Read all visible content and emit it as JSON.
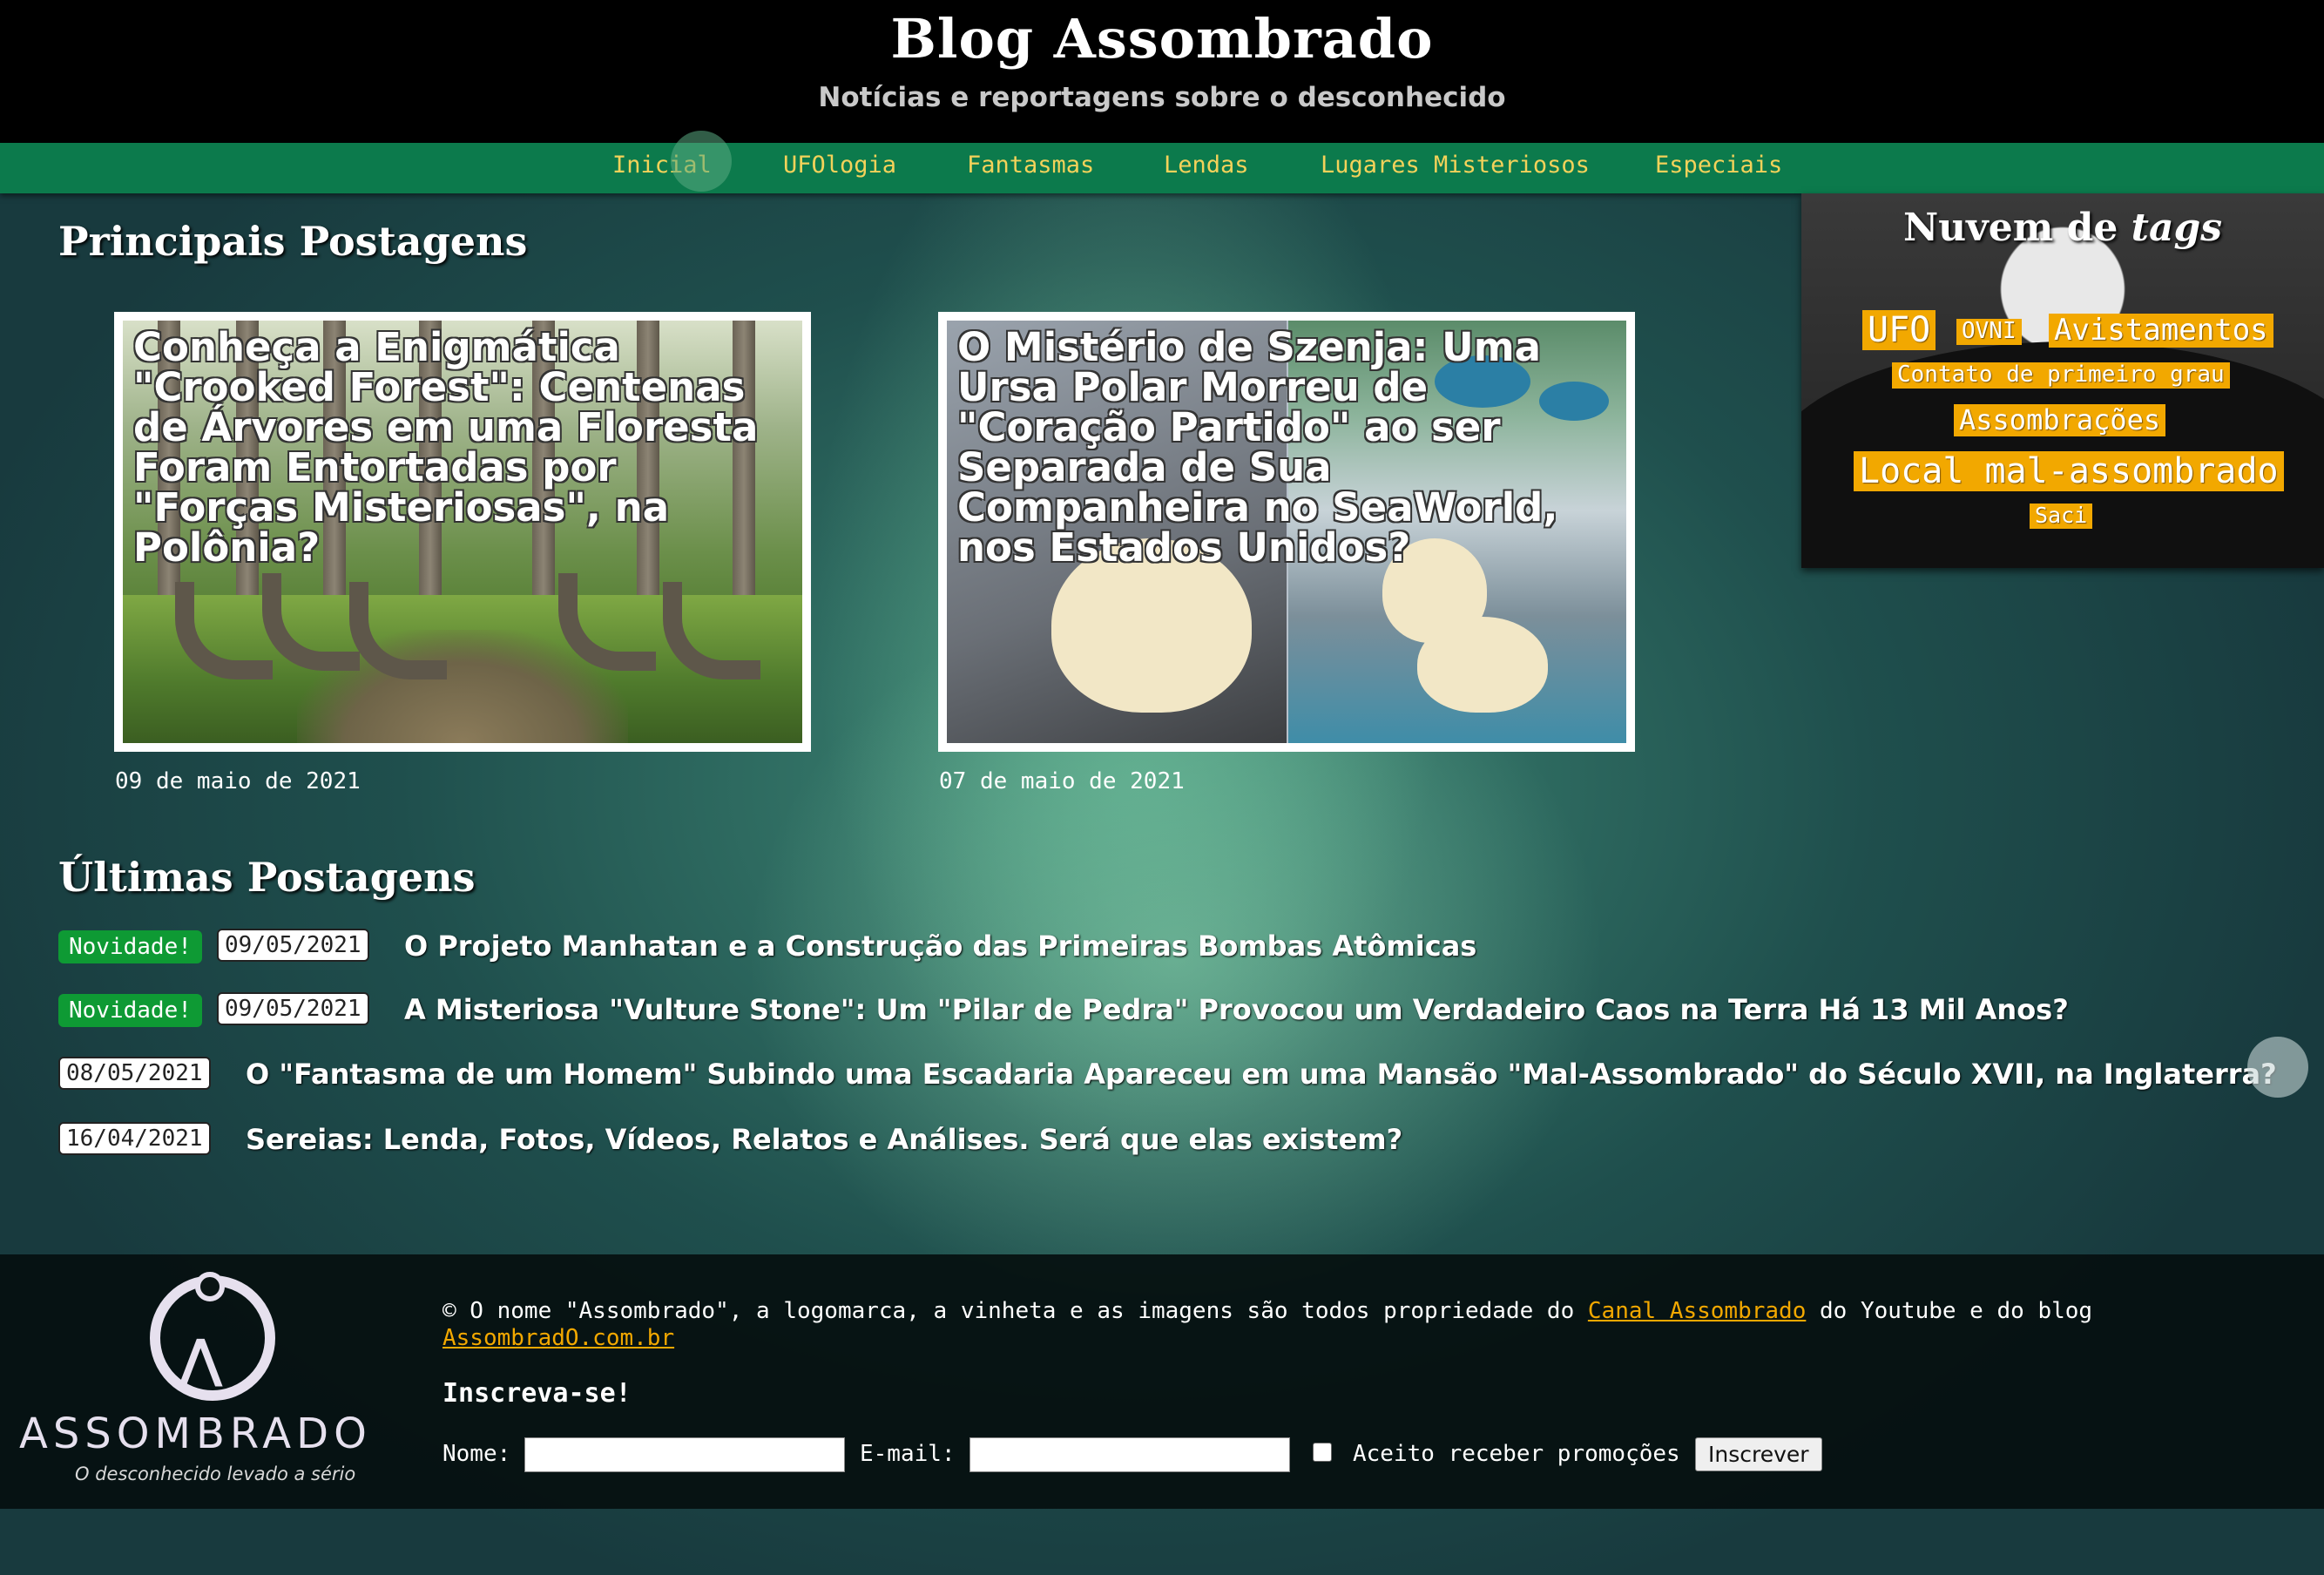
{
  "header": {
    "title": "Blog Assombrado",
    "subtitle": "Notícias e reportagens sobre o desconhecido"
  },
  "nav": {
    "items": [
      "Inicial",
      "UFOlogia",
      "Fantasmas",
      "Lendas",
      "Lugares Misteriosos",
      "Especiais"
    ]
  },
  "featured": {
    "heading": "Principais Postagens",
    "posts": [
      {
        "title": "Conheça a Enigmática \"Crooked Forest\": Centenas de Árvores em uma Floresta Foram Entortadas por \"Forças Misteriosas\", na Polônia?",
        "date": "09 de maio de 2021"
      },
      {
        "title": "O Mistério de Szenja: Uma Ursa Polar Morreu de \"Coração Partido\" ao ser Separada de Sua Companheira no SeaWorld, nos Estados Unidos?",
        "date": "07 de maio de 2021"
      }
    ]
  },
  "tagcloud": {
    "title_main": "Nuvem de ",
    "title_em": "tags",
    "tags": [
      "UFO",
      "OVNI",
      "Avistamentos",
      "Contato de primeiro grau",
      "Assombrações",
      "Local mal-assombrado",
      "Saci"
    ]
  },
  "latest": {
    "heading": "Últimas Postagens",
    "new_label": "Novidade!",
    "posts": [
      {
        "date": "09/05/2021",
        "title": "O Projeto Manhatan e a Construção das Primeiras Bombas Atômicas"
      },
      {
        "date": "09/05/2021",
        "title": "A Misteriosa \"Vulture Stone\": Um \"Pilar de Pedra\" Provocou um Verdadeiro Caos na Terra Há 13 Mil Anos?"
      },
      {
        "date": "08/05/2021",
        "title": "O \"Fantasma de um Homem\" Subindo uma Escadaria Apareceu em uma Mansão \"Mal-Assombrado\" do Século XVII, na Inglaterra?"
      },
      {
        "date": "16/04/2021",
        "title": "Sereias: Lenda, Fotos, Vídeos, Relatos e Análises. Será que elas existem?"
      }
    ]
  },
  "footer": {
    "logo_word": "ASSOMBRADO",
    "logo_tagline": "O desconhecido levado a sério",
    "copyright_before": "© O nome \"Assombrado\", a logomarca, a vinheta e as imagens são todos propriedade do ",
    "channel_link": "Canal Assombrado",
    "copyright_middle": " do Youtube e do blog ",
    "blog_link": "AssombradO.com.br",
    "subscribe_title": "Inscreva-se!",
    "name_label": "Nome:",
    "email_label": "E-mail:",
    "name_value": "",
    "email_value": "",
    "promo_label": "Aceito receber promoções",
    "submit_label": "Inscrever"
  }
}
